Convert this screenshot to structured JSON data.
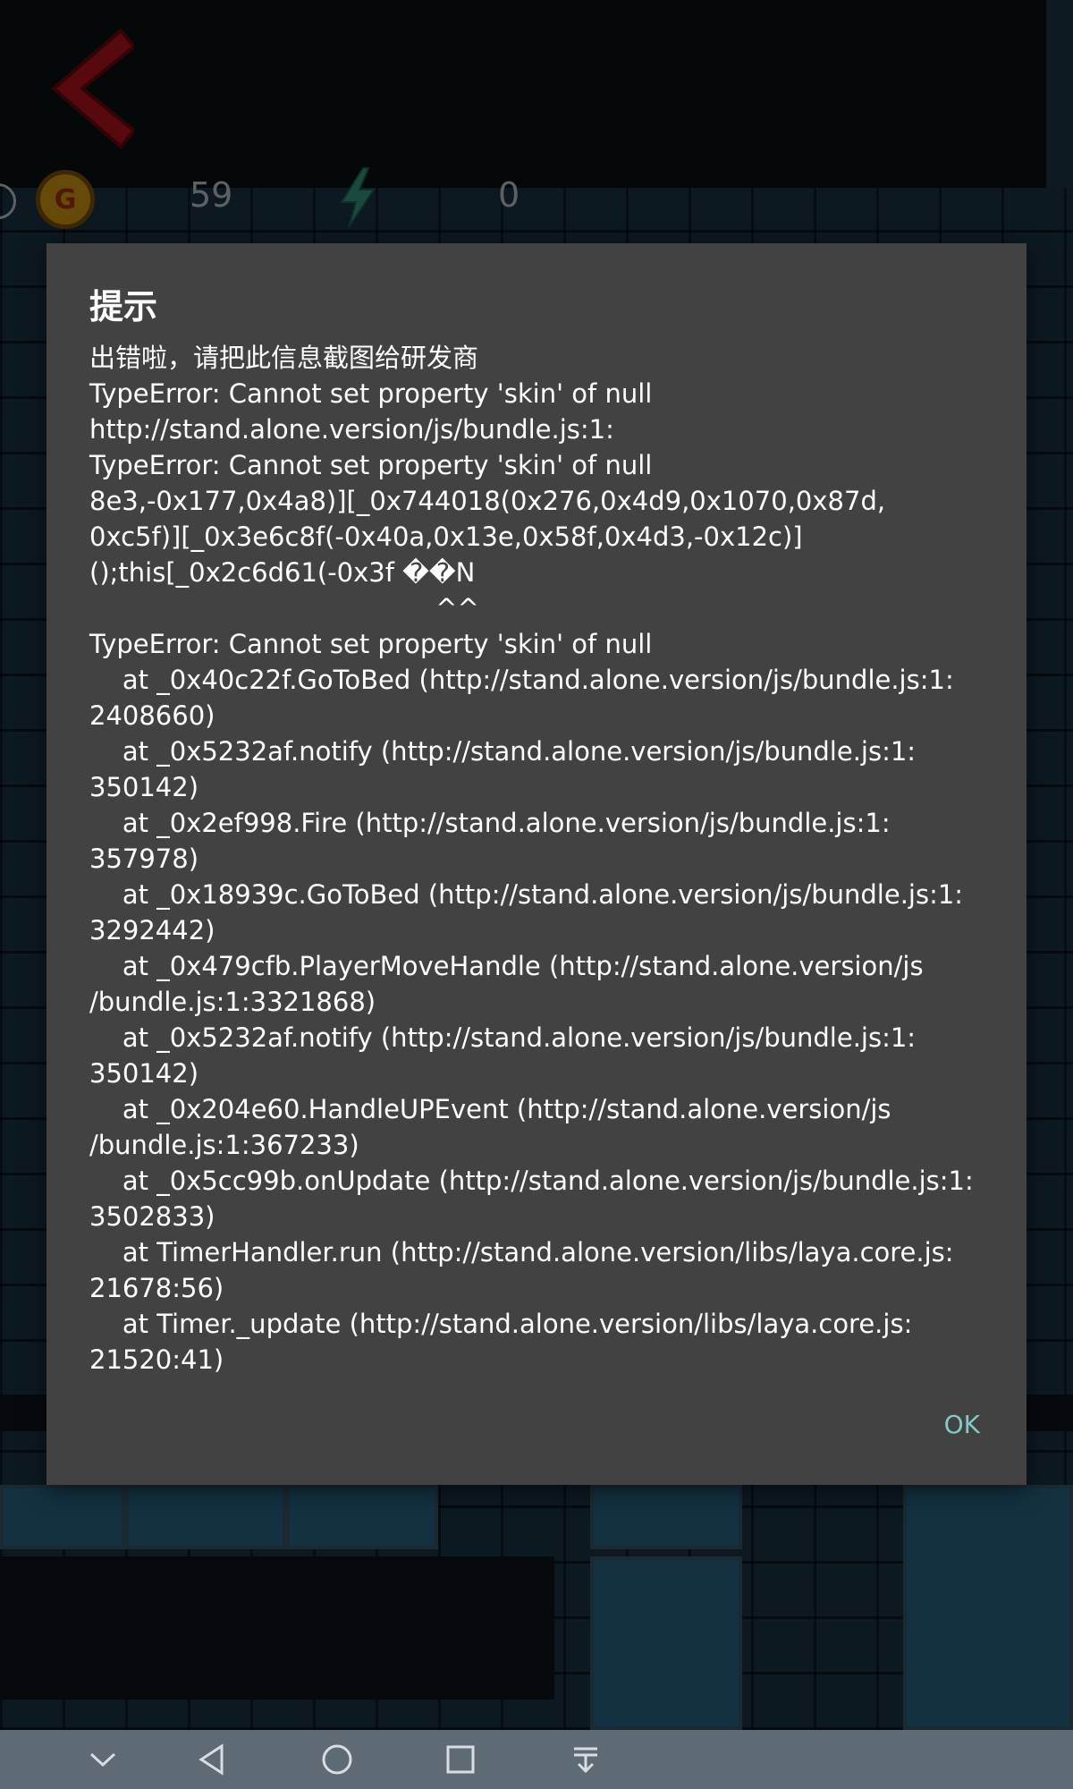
{
  "hud": {
    "coin_icon_label": "G",
    "coin_count": "59",
    "energy_count": "0"
  },
  "dialog": {
    "title": "提示",
    "message": "出错啦，请把此信息截图给研发商\nTypeError: Cannot set property 'skin' of null\nhttp://stand.alone.version/js/bundle.js:1:\nTypeError: Cannot set property 'skin' of null\n8e3,-0x177,0x4a8)][_0x744018(0x276,0x4d9,0x1070,0x87d,\n0xc5f)][_0x3e6c8f(-0x40a,0x13e,0x58f,0x4d3,-0x12c)]\n();this[_0x2c6d61(-0x3f ��N\n                                          ^^\nTypeError: Cannot set property 'skin' of null\n    at _0x40c22f.GoToBed (http://stand.alone.version/js/bundle.js:1:\n2408660)\n    at _0x5232af.notify (http://stand.alone.version/js/bundle.js:1:\n350142)\n    at _0x2ef998.Fire (http://stand.alone.version/js/bundle.js:1:\n357978)\n    at _0x18939c.GoToBed (http://stand.alone.version/js/bundle.js:1:\n3292442)\n    at _0x479cfb.PlayerMoveHandle (http://stand.alone.version/js\n/bundle.js:1:3321868)\n    at _0x5232af.notify (http://stand.alone.version/js/bundle.js:1:\n350142)\n    at _0x204e60.HandleUPEvent (http://stand.alone.version/js\n/bundle.js:1:367233)\n    at _0x5cc99b.onUpdate (http://stand.alone.version/js/bundle.js:1:\n3502833)\n    at TimerHandler.run (http://stand.alone.version/libs/laya.core.js:\n21678:56)\n    at Timer._update (http://stand.alone.version/libs/laya.core.js:\n21520:41)",
    "ok_label": "OK"
  },
  "navbar": {
    "icons": [
      "chevron-down-icon",
      "back-icon",
      "home-icon",
      "recents-icon",
      "pull-down-icon"
    ]
  },
  "colors": {
    "dialog_bg": "#424242",
    "accent": "#80cbc4",
    "back_arrow": "#c0141e",
    "navbar_bg": "#5e6a74"
  }
}
